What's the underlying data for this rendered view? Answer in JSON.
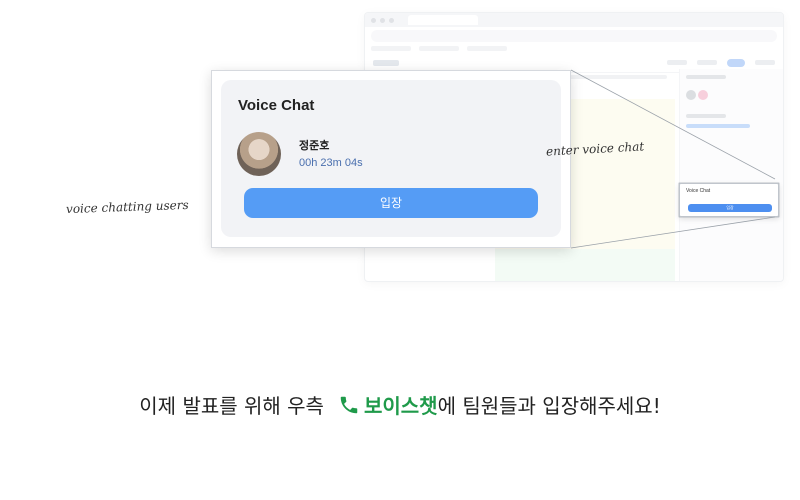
{
  "voice_chat": {
    "title": "Voice Chat",
    "user_name": "정준호",
    "elapsed_time": "00h 23m 04s",
    "enter_label": "입장"
  },
  "annotations": {
    "users": "voice chatting users",
    "enter": "enter voice chat"
  },
  "caption": {
    "before": "이제 발표를 위해 우측",
    "highlight": "보이스챗",
    "after": "에 팀원들과 입장해주세요!",
    "icon": "phone-icon"
  },
  "colors": {
    "accent_blue": "#559cf5",
    "highlight_green": "#1f9a4a",
    "card_bg": "#f2f3f6"
  }
}
